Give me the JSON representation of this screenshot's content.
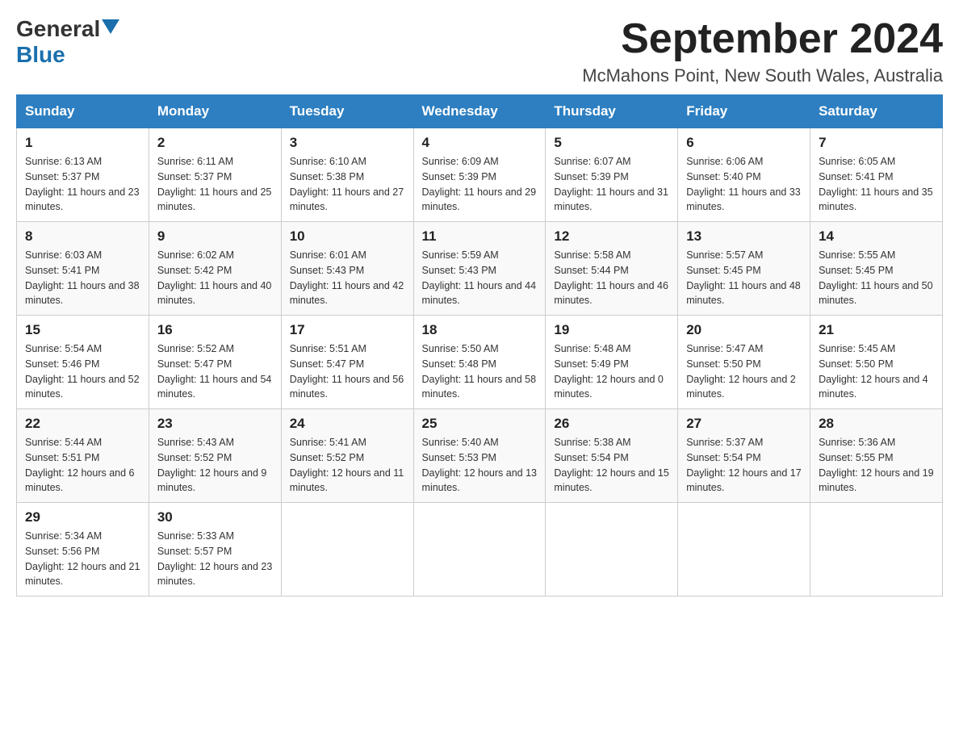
{
  "header": {
    "logo_general": "General",
    "logo_blue": "Blue",
    "month_year": "September 2024",
    "location": "McMahons Point, New South Wales, Australia"
  },
  "days_of_week": [
    "Sunday",
    "Monday",
    "Tuesday",
    "Wednesday",
    "Thursday",
    "Friday",
    "Saturday"
  ],
  "weeks": [
    [
      {
        "day": 1,
        "sunrise": "6:13 AM",
        "sunset": "5:37 PM",
        "daylight": "11 hours and 23 minutes."
      },
      {
        "day": 2,
        "sunrise": "6:11 AM",
        "sunset": "5:37 PM",
        "daylight": "11 hours and 25 minutes."
      },
      {
        "day": 3,
        "sunrise": "6:10 AM",
        "sunset": "5:38 PM",
        "daylight": "11 hours and 27 minutes."
      },
      {
        "day": 4,
        "sunrise": "6:09 AM",
        "sunset": "5:39 PM",
        "daylight": "11 hours and 29 minutes."
      },
      {
        "day": 5,
        "sunrise": "6:07 AM",
        "sunset": "5:39 PM",
        "daylight": "11 hours and 31 minutes."
      },
      {
        "day": 6,
        "sunrise": "6:06 AM",
        "sunset": "5:40 PM",
        "daylight": "11 hours and 33 minutes."
      },
      {
        "day": 7,
        "sunrise": "6:05 AM",
        "sunset": "5:41 PM",
        "daylight": "11 hours and 35 minutes."
      }
    ],
    [
      {
        "day": 8,
        "sunrise": "6:03 AM",
        "sunset": "5:41 PM",
        "daylight": "11 hours and 38 minutes."
      },
      {
        "day": 9,
        "sunrise": "6:02 AM",
        "sunset": "5:42 PM",
        "daylight": "11 hours and 40 minutes."
      },
      {
        "day": 10,
        "sunrise": "6:01 AM",
        "sunset": "5:43 PM",
        "daylight": "11 hours and 42 minutes."
      },
      {
        "day": 11,
        "sunrise": "5:59 AM",
        "sunset": "5:43 PM",
        "daylight": "11 hours and 44 minutes."
      },
      {
        "day": 12,
        "sunrise": "5:58 AM",
        "sunset": "5:44 PM",
        "daylight": "11 hours and 46 minutes."
      },
      {
        "day": 13,
        "sunrise": "5:57 AM",
        "sunset": "5:45 PM",
        "daylight": "11 hours and 48 minutes."
      },
      {
        "day": 14,
        "sunrise": "5:55 AM",
        "sunset": "5:45 PM",
        "daylight": "11 hours and 50 minutes."
      }
    ],
    [
      {
        "day": 15,
        "sunrise": "5:54 AM",
        "sunset": "5:46 PM",
        "daylight": "11 hours and 52 minutes."
      },
      {
        "day": 16,
        "sunrise": "5:52 AM",
        "sunset": "5:47 PM",
        "daylight": "11 hours and 54 minutes."
      },
      {
        "day": 17,
        "sunrise": "5:51 AM",
        "sunset": "5:47 PM",
        "daylight": "11 hours and 56 minutes."
      },
      {
        "day": 18,
        "sunrise": "5:50 AM",
        "sunset": "5:48 PM",
        "daylight": "11 hours and 58 minutes."
      },
      {
        "day": 19,
        "sunrise": "5:48 AM",
        "sunset": "5:49 PM",
        "daylight": "12 hours and 0 minutes."
      },
      {
        "day": 20,
        "sunrise": "5:47 AM",
        "sunset": "5:50 PM",
        "daylight": "12 hours and 2 minutes."
      },
      {
        "day": 21,
        "sunrise": "5:45 AM",
        "sunset": "5:50 PM",
        "daylight": "12 hours and 4 minutes."
      }
    ],
    [
      {
        "day": 22,
        "sunrise": "5:44 AM",
        "sunset": "5:51 PM",
        "daylight": "12 hours and 6 minutes."
      },
      {
        "day": 23,
        "sunrise": "5:43 AM",
        "sunset": "5:52 PM",
        "daylight": "12 hours and 9 minutes."
      },
      {
        "day": 24,
        "sunrise": "5:41 AM",
        "sunset": "5:52 PM",
        "daylight": "12 hours and 11 minutes."
      },
      {
        "day": 25,
        "sunrise": "5:40 AM",
        "sunset": "5:53 PM",
        "daylight": "12 hours and 13 minutes."
      },
      {
        "day": 26,
        "sunrise": "5:38 AM",
        "sunset": "5:54 PM",
        "daylight": "12 hours and 15 minutes."
      },
      {
        "day": 27,
        "sunrise": "5:37 AM",
        "sunset": "5:54 PM",
        "daylight": "12 hours and 17 minutes."
      },
      {
        "day": 28,
        "sunrise": "5:36 AM",
        "sunset": "5:55 PM",
        "daylight": "12 hours and 19 minutes."
      }
    ],
    [
      {
        "day": 29,
        "sunrise": "5:34 AM",
        "sunset": "5:56 PM",
        "daylight": "12 hours and 21 minutes."
      },
      {
        "day": 30,
        "sunrise": "5:33 AM",
        "sunset": "5:57 PM",
        "daylight": "12 hours and 23 minutes."
      },
      null,
      null,
      null,
      null,
      null
    ]
  ]
}
